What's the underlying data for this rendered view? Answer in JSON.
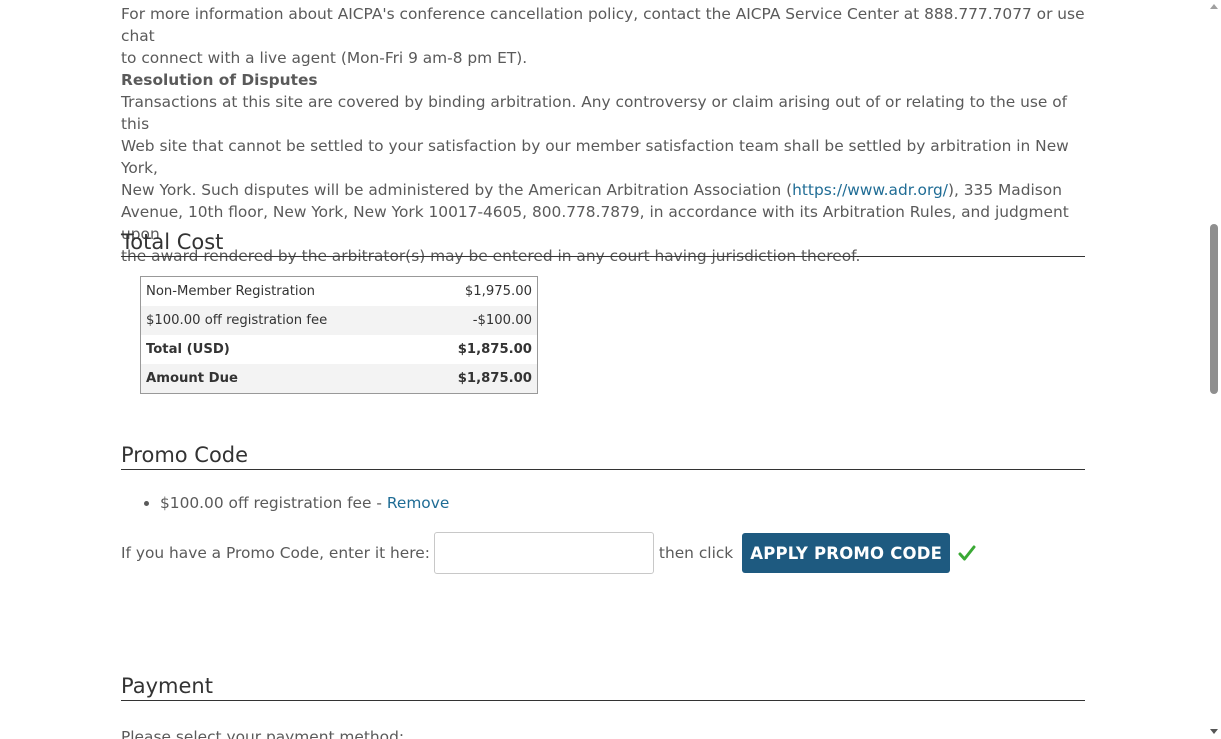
{
  "cancellation": {
    "text_before": "For more information about AICPA's conference cancellation policy, contact the AICPA Service Center at 888.777.7077 or use chat",
    "text_after": "to connect with a live agent (Mon-Fri 9 am-8 pm ET)."
  },
  "disputes": {
    "title": "Resolution of Disputes",
    "line1": "Transactions at this site are covered by binding arbitration. Any controversy or claim arising out of or relating to the use of this",
    "line2": "Web site that cannot be settled to your satisfaction by our member satisfaction team shall be settled by arbitration in New York,",
    "line3_before": "New York. Such disputes will be administered by the American Arbitration Association (",
    "link": "https://www.adr.org/",
    "line3_after": "), 335 Madison",
    "line4": "Avenue, 10th floor, New York, New York 10017-4605, 800.778.7879, in accordance with its Arbitration Rules, and judgment upon",
    "line5": "the award rendered by the arbitrator(s) may be entered in any court having jurisdiction thereof."
  },
  "total_cost": {
    "heading": "Total Cost",
    "rows": [
      {
        "label": "Non-Member Registration",
        "amount": "$1,975.00"
      },
      {
        "label": "$100.00 off registration fee",
        "amount": "-$100.00"
      },
      {
        "label": "Total (USD)",
        "amount": "$1,875.00"
      },
      {
        "label": "Amount Due",
        "amount": "$1,875.00"
      }
    ]
  },
  "promo": {
    "heading": "Promo Code",
    "applied_item": "$100.00 off registration fee - ",
    "remove_label": "Remove",
    "prompt": "If you have a Promo Code, enter it here:",
    "input_value": "",
    "then_click": "then click",
    "apply_label": "APPLY PROMO CODE",
    "check_color": "#3aa935"
  },
  "payment": {
    "heading": "Payment",
    "prompt": "Please select your payment method:"
  }
}
